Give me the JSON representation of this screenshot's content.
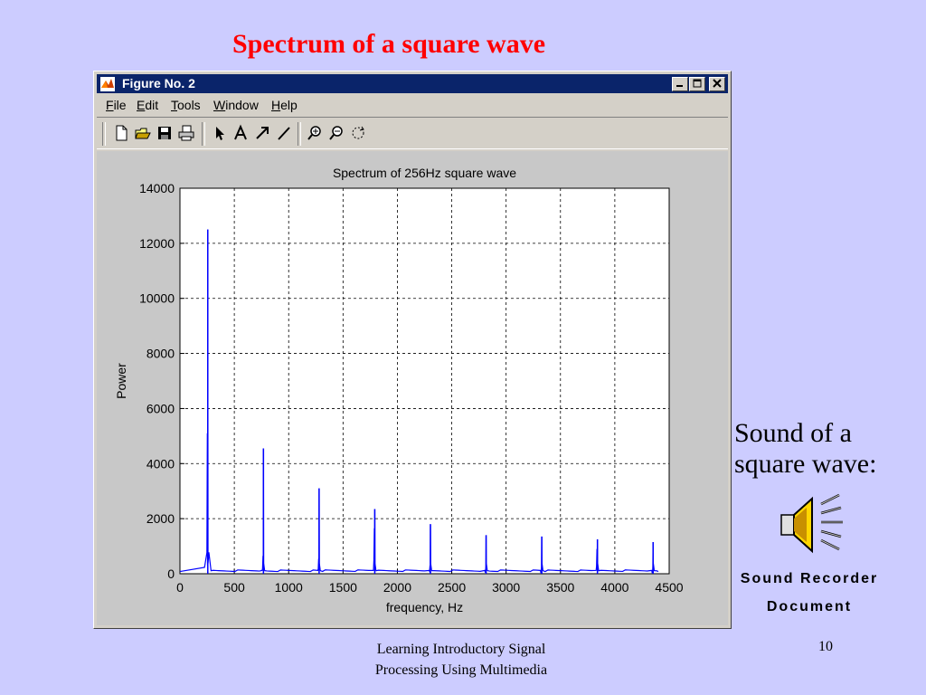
{
  "slide": {
    "title": "Spectrum of a square wave",
    "side_text_line1": "Sound of a",
    "side_text_line2": "square wave:",
    "recorder_label_line1": "Sound Recorder",
    "recorder_label_line2": "Document",
    "footer_line1": "Learning Introductory Signal",
    "footer_line2": "Processing Using Multimedia",
    "page_number": "10"
  },
  "window": {
    "title": "Figure No. 2",
    "menu": [
      {
        "label": "File",
        "key": "F",
        "rest": "ile"
      },
      {
        "label": "Edit",
        "key": "E",
        "rest": "dit"
      },
      {
        "label": "Tools",
        "key": "T",
        "rest": "ools"
      },
      {
        "label": "Window",
        "key": "W",
        "rest": "indow"
      },
      {
        "label": "Help",
        "key": "H",
        "rest": "elp"
      }
    ],
    "toolbar_icons": [
      "new-file-icon",
      "open-folder-icon",
      "save-icon",
      "print-icon",
      "arrow-cursor-icon",
      "text-A-icon",
      "arrow-icon",
      "line-icon",
      "zoom-in-icon",
      "zoom-out-icon",
      "rotate-icon"
    ]
  },
  "colors": {
    "title_red": "#ff0000",
    "titlebar_blue": "#0a246a",
    "series_blue": "#0000ff",
    "background": "#ccccff"
  },
  "chart_data": {
    "type": "line",
    "title": "Spectrum of 256Hz square wave",
    "xlabel": "frequency, Hz",
    "ylabel": "Power",
    "xlim": [
      0,
      4500
    ],
    "ylim": [
      0,
      14000
    ],
    "xticks": [
      0,
      500,
      1000,
      1500,
      2000,
      2500,
      3000,
      3500,
      4000,
      4500
    ],
    "yticks": [
      0,
      2000,
      4000,
      6000,
      8000,
      10000,
      12000,
      14000
    ],
    "grid": true,
    "peaks": [
      {
        "x": 256,
        "y": 12500,
        "shoulder": 5100
      },
      {
        "x": 768,
        "y": 4550,
        "shoulder": 650
      },
      {
        "x": 1280,
        "y": 3100,
        "shoulder": 550
      },
      {
        "x": 1792,
        "y": 2350,
        "shoulder": 1650
      },
      {
        "x": 2304,
        "y": 1800,
        "shoulder": 300
      },
      {
        "x": 2816,
        "y": 1400,
        "shoulder": 150
      },
      {
        "x": 3328,
        "y": 1350,
        "shoulder": 100
      },
      {
        "x": 3840,
        "y": 1250,
        "shoulder": 900
      },
      {
        "x": 4352,
        "y": 1150,
        "shoulder": 100
      }
    ],
    "baseline": 80
  }
}
